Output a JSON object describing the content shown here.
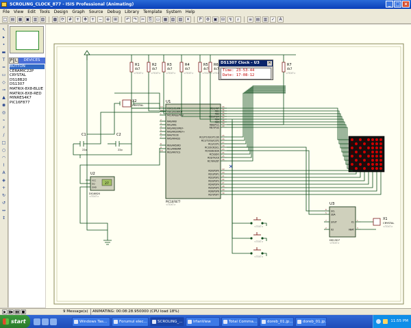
{
  "window": {
    "title": "SCROLING_CLOCK_877 - ISIS Professional (Animating)",
    "controls": [
      "_",
      "□",
      "×"
    ]
  },
  "menu": [
    "File",
    "View",
    "Edit",
    "Tools",
    "Design",
    "Graph",
    "Source",
    "Debug",
    "Library",
    "Template",
    "System",
    "Help"
  ],
  "toolbar": {
    "icons": [
      "new-icon",
      "open-icon",
      "save-icon",
      "import-icon",
      "export-icon",
      "print-icon",
      "area-icon",
      "refresh-icon",
      "grid-icon",
      "origin-icon",
      "pan-icon",
      "zoom-in-icon",
      "zoom-out-icon",
      "zoom-all-icon",
      "zoom-area-icon",
      "undo-icon",
      "redo-icon",
      "cut-icon",
      "copy-icon",
      "paste-icon",
      "block-copy-icon",
      "block-move-icon",
      "block-rotate-icon",
      "block-delete-icon",
      "pick-icon",
      "make-device-icon",
      "package-icon",
      "decompose-icon",
      "wire-autoroute-icon",
      "search-icon",
      "property-icon",
      "netlist-icon",
      "bom-icon",
      "erc-icon",
      "ares-icon"
    ],
    "glyphs": [
      "□",
      "▤",
      "▦",
      "▣",
      "▥",
      "▧",
      "▩",
      "⟳",
      "#",
      "+",
      "✥",
      "+",
      "−",
      "⊕",
      "⊞",
      "↶",
      "↷",
      "✂",
      "⎘",
      "▭",
      "▦",
      "▧",
      "▨",
      "✕",
      "P",
      "⚙",
      "▣",
      "⊟",
      "↯",
      "⌕",
      "≡",
      "▤",
      "▥",
      "✓",
      "A"
    ]
  },
  "side_tools": {
    "icons": [
      "select-icon",
      "component-icon",
      "junction-icon",
      "label-icon",
      "text-icon",
      "bus-icon",
      "subcircuit-icon",
      "terminal-icon",
      "pin-icon",
      "graph-icon",
      "tape-icon",
      "generator-icon",
      "probe-icon",
      "instrument-icon",
      "line-icon",
      "box-icon",
      "circle-icon",
      "arc-icon",
      "path-icon",
      "text2-icon",
      "symbol-icon",
      "marker-icon",
      "rotate-cw-icon",
      "rotate-ccw-icon",
      "mirror-x-icon",
      "mirror-y-icon"
    ],
    "glyphs": [
      "↖",
      "▸",
      "•",
      "▬",
      "T",
      "═",
      "▭",
      "◇",
      "⊸",
      "▲",
      "◉",
      "◎",
      "⌁",
      "⚡",
      "/",
      "□",
      "○",
      "◠",
      "⌇",
      "A",
      "◈",
      "+",
      "↻",
      "↺",
      "↔",
      "↕"
    ]
  },
  "device_panel": {
    "tab_p": "P",
    "tab_l": "L",
    "tab_devices": "DEVICES",
    "devices": [
      "BUTTON",
      "CERAMIC22P",
      "CRYSTAL",
      "DS18B20",
      "DS1307",
      "MATRIX-8X8-BLUE",
      "MATRIX-8X8-RED",
      "MINRES4K7",
      "PIC16F877"
    ],
    "selected_index": 0
  },
  "schematic": {
    "resistors": [
      "R1",
      "R2",
      "R3",
      "R4",
      "R5",
      "R6",
      "R7"
    ],
    "resistor_value": "4k7",
    "text_placeholder": "<TEXT>",
    "x2": "X2",
    "x1": "X1",
    "crystal": "CRYSTAL",
    "c1": "C1",
    "c2": "C2",
    "cap_value": "22p",
    "u1": "U1",
    "u1_part": "PIC16F877",
    "u2": "U2",
    "u2_part": "DS18B20",
    "u3": "U3",
    "u3_part": "DS1307",
    "u2_pins": [
      "VCC",
      "DQ",
      "GND"
    ],
    "u3_pins": [
      "SCL",
      "SDA",
      "SOUT",
      "X1",
      "X2",
      "VBAT"
    ],
    "u3_pin_numbers": [
      "6",
      "5",
      "7",
      "1",
      "2",
      "3"
    ],
    "left_pins": [
      "OSC1/CLKIN",
      "OSC2/CLKOUT",
      "MCLR/Vpp/THV",
      "RA0/AN0",
      "RA1/AN1",
      "RA2/AN2/VREF-",
      "RA3/AN3/VREF+",
      "RA4/T0CKI",
      "RA5/AN4/SS",
      "RE0/AN5/RD",
      "RE1/AN6/WR",
      "RE2/AN7/CS"
    ],
    "left_pin_numbers": [
      "13",
      "14",
      "1",
      "2",
      "3",
      "4",
      "5",
      "6",
      "7",
      "8",
      "9",
      "10"
    ],
    "right_pins": [
      "RB0/INT",
      "RB1",
      "RB2",
      "RB3/PGM",
      "RB4",
      "RB5",
      "RB6/PGC",
      "RB7/PGD",
      "RC0/T1OSO/T1CKI",
      "RC1/T1OSI/CCP2",
      "RC2/CCP1",
      "RC3/SCK/SCL",
      "RC4/SDI/SDA",
      "RC5/SDO",
      "RC6/TX/CK",
      "RC7/RX/DT",
      "RD0/PSP0",
      "RD1/PSP1",
      "RD2/PSP2",
      "RD3/PSP3",
      "RD4/PSP4",
      "RD5/PSP5",
      "RD6/PSP6",
      "RD7/PSP7"
    ],
    "right_pin_numbers": [
      "33",
      "34",
      "35",
      "36",
      "37",
      "38",
      "39",
      "40",
      "15",
      "16",
      "17",
      "18",
      "23",
      "24",
      "25",
      "26",
      "19",
      "20",
      "21",
      "22",
      "27",
      "28",
      "29",
      "30"
    ],
    "led_matrix": {
      "rows": 8,
      "cols": 8,
      "color": "#cc0000",
      "dark": "#3a0000"
    },
    "thermometer_display": "27",
    "colors": {
      "wire": "#0a4a1a",
      "component": "#7a1a1a",
      "chip_fill": "#cfd0bc",
      "border": "#1a3a1a",
      "pin": "#7a1a1a"
    }
  },
  "ds1307_popup": {
    "title": "DS1307 Clock - U3",
    "time_label": "Time:",
    "time_value": "23-53-44",
    "date_label": "Date:",
    "date_value": "17-08-12"
  },
  "status": {
    "messages": "9 Message(s)",
    "animating": "ANIMATING: 00:08:28.950000 (CPU load 18%)",
    "play_buttons": [
      "▶",
      "▮▶",
      "▮▮",
      "■"
    ]
  },
  "taskbar": {
    "start": "start",
    "tasks": [
      "Windows Tas...",
      "Forumul elec...",
      "SCROLING_...",
      "IrfanView",
      "Total Comma...",
      "doreb_01.jp...",
      "doreb_01.jp..."
    ],
    "active_index": 2,
    "clock": "11:55 PM"
  }
}
